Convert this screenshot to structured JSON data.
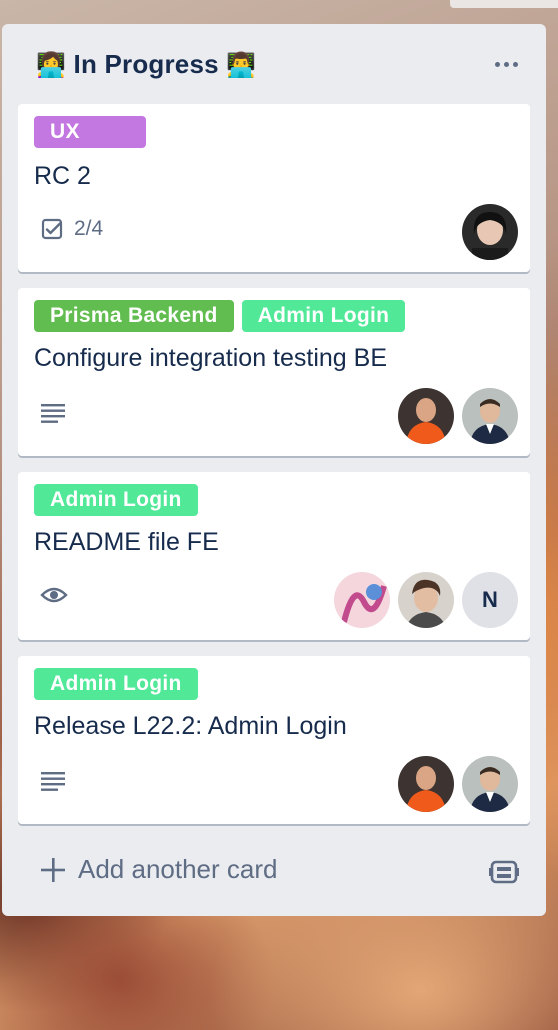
{
  "list": {
    "emoji_left": "👩‍💻",
    "title": "In Progress",
    "emoji_right": "👨‍💻",
    "menu_icon": "more-horizontal-icon"
  },
  "cards": [
    {
      "labels": [
        {
          "text": "UX",
          "color": "#c377e0"
        }
      ],
      "title": "RC 2",
      "checklist": "2/4",
      "members": [
        "avatar-woman-dark-hair"
      ]
    },
    {
      "labels": [
        {
          "text": "Prisma Backend",
          "color": "#61bd4f"
        },
        {
          "text": "Admin Login",
          "color": "#51e898"
        }
      ],
      "title": "Configure integration testing BE",
      "members": [
        "avatar-man-orange-shirt",
        "avatar-man-suit"
      ]
    },
    {
      "labels": [
        {
          "text": "Admin Login",
          "color": "#51e898"
        }
      ],
      "title": "README file FE",
      "members": [
        "avatar-pink-illustration",
        "avatar-man-glasses",
        "N"
      ]
    },
    {
      "labels": [
        {
          "text": "Admin Login",
          "color": "#51e898"
        }
      ],
      "title": "Release L22.2: Admin Login",
      "members": [
        "avatar-man-orange-shirt",
        "avatar-man-suit"
      ]
    }
  ],
  "footer": {
    "add_card_label": "Add another card",
    "template_icon": "card-template-icon"
  }
}
